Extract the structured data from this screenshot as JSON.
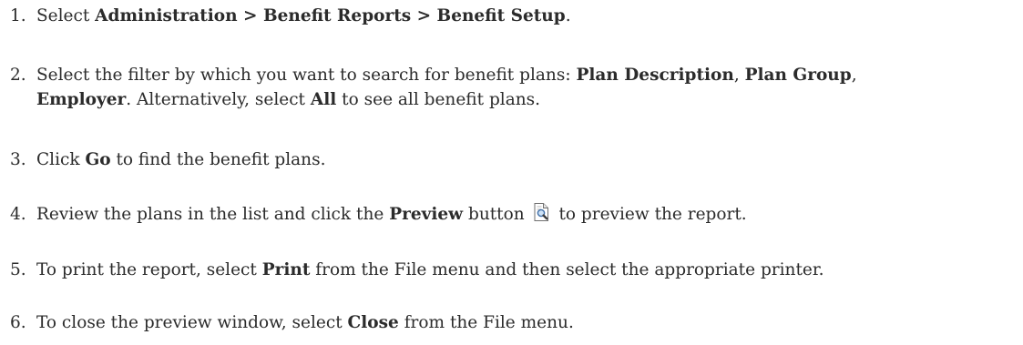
{
  "steps": [
    {
      "number": "1.",
      "parts": [
        "Select ",
        "Administration > Benefit Reports > Benefit Setup",
        "."
      ]
    },
    {
      "number": "2.",
      "parts": [
        "Select the filter by which you want to search for benefit plans: ",
        "Plan Description",
        ", ",
        "Plan Group",
        ", ",
        "Employer",
        ". Alternatively, select ",
        "All",
        " to see all benefit plans."
      ]
    },
    {
      "number": "3.",
      "parts": [
        "Click ",
        "Go",
        " to find the benefit plans."
      ]
    },
    {
      "number": "4.",
      "parts": [
        "Review the plans in the list and click the ",
        "Preview",
        " button ",
        " to preview the report."
      ],
      "icon": "preview-report-icon"
    },
    {
      "number": "5.",
      "parts": [
        "To print the report, select ",
        "Print",
        " from the File menu and then select the appropriate printer."
      ]
    },
    {
      "number": "6.",
      "parts": [
        "To close the preview window, select ",
        "Close",
        " from the File menu."
      ]
    }
  ]
}
